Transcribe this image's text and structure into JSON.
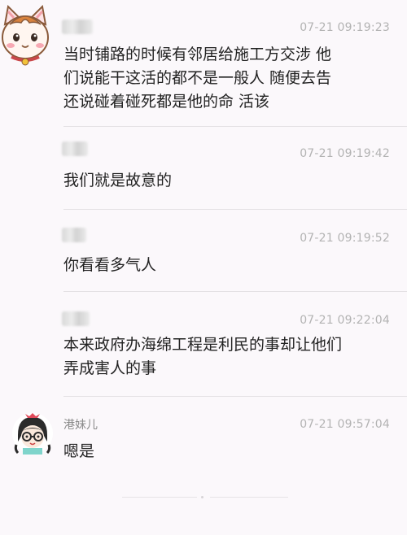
{
  "messages": [
    {
      "sender": "",
      "time": "07-21 09:19:23",
      "text": "当时铺路的时候有邻居给施工方交涉  他\n们说能干这活的都不是一般人 随便去告\n还说碰着碰死都是他的命 活该"
    },
    {
      "sender": "",
      "time": "07-21 09:19:42",
      "text": "我们就是故意的"
    },
    {
      "sender": "",
      "time": "07-21 09:19:52",
      "text": "你看看多气人"
    },
    {
      "sender": "",
      "time": "07-21 09:22:04",
      "text": "本来政府办海绵工程是利民的事却让他们\n弄成害人的事"
    },
    {
      "sender": "港妹儿",
      "time": "07-21 09:57:04",
      "text": "嗯是"
    }
  ],
  "colors": {
    "background": "#fbf8fb",
    "text": "#222222",
    "timestamp": "#b3b3b3",
    "sender": "#8a8a8a"
  },
  "icons": [
    "cat-avatar-icon",
    "girl-avatar-icon"
  ]
}
